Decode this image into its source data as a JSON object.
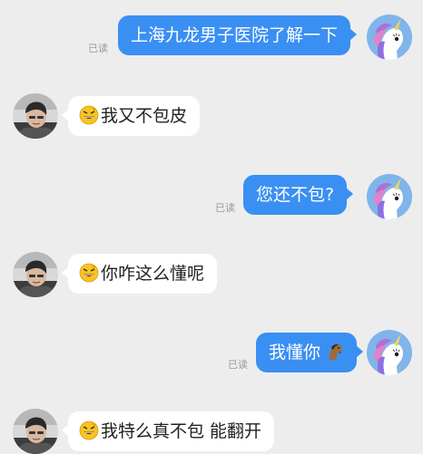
{
  "messages": [
    {
      "side": "out",
      "text": "上海九龙男子医院了解一下",
      "read": "已读"
    },
    {
      "side": "in",
      "emoji": "grinning-emoji",
      "text": "我又不包皮"
    },
    {
      "side": "out",
      "text": "您还不包?",
      "read": "已读"
    },
    {
      "side": "in",
      "emoji": "grinning-emoji",
      "text": "你咋这么懂呢"
    },
    {
      "side": "out",
      "text": "我懂你",
      "trailing_emoji": "horse-emoji",
      "read": "已读"
    },
    {
      "side": "in",
      "emoji": "grinning-emoji",
      "text": "我特么真不包 能翻开"
    }
  ],
  "colors": {
    "background": "#ededed",
    "outgoing_bubble": "#3a8ff3",
    "incoming_bubble": "#ffffff",
    "read_receipt": "#9a9a9a"
  }
}
